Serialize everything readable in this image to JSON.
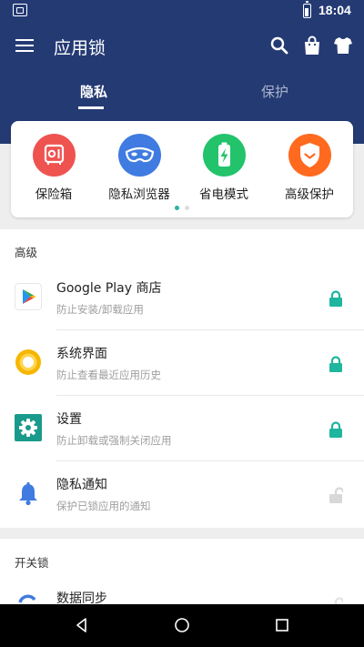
{
  "status_bar": {
    "time": "18:04"
  },
  "app_bar": {
    "title": "应用锁",
    "tabs": [
      {
        "label": "隐私",
        "active": true
      },
      {
        "label": "保护",
        "active": false
      }
    ]
  },
  "features": [
    {
      "label": "保险箱",
      "icon": "safe-icon",
      "color": "#ef5350"
    },
    {
      "label": "隐私浏览器",
      "icon": "mask-icon",
      "color": "#3f7be0"
    },
    {
      "label": "省电模式",
      "icon": "battery-bolt-icon",
      "color": "#22c36b"
    },
    {
      "label": "高级保护",
      "icon": "shield-icon",
      "color": "#ff6a1f"
    }
  ],
  "pager": {
    "pages": 2,
    "current": 1,
    "active_color": "#26b3a8",
    "inactive_color": "#dddddd"
  },
  "sections": {
    "advanced": {
      "header": "高级",
      "items": [
        {
          "title": "Google Play 商店",
          "subtitle": "防止安装/卸载应用",
          "icon": "google-play-icon",
          "locked": true
        },
        {
          "title": "系统界面",
          "subtitle": "防止查看最近应用历史",
          "icon": "system-ui-icon",
          "locked": true
        },
        {
          "title": "设置",
          "subtitle": "防止卸载或强制关闭应用",
          "icon": "settings-icon",
          "locked": true
        },
        {
          "title": "隐私通知",
          "subtitle": "保护已锁应用的通知",
          "icon": "bell-icon",
          "locked": false
        }
      ]
    },
    "switch_lock": {
      "header": "开关锁",
      "items": [
        {
          "title": "数据同步",
          "icon": "sync-icon",
          "locked": false
        }
      ]
    }
  },
  "colors": {
    "primary": "#243a73",
    "accent": "#1fb59e",
    "unlocked": "#d8d8d8"
  }
}
